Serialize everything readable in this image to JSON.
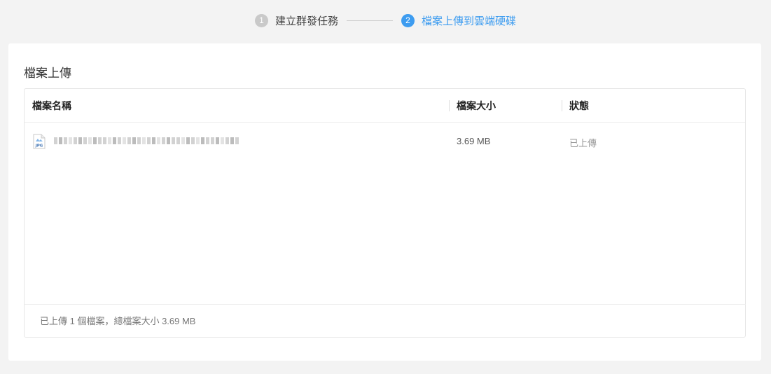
{
  "steps": [
    {
      "number": "1",
      "label": "建立群發任務",
      "state": "done"
    },
    {
      "number": "2",
      "label": "檔案上傳到雲端硬碟",
      "state": "active"
    }
  ],
  "colors": {
    "accent": "#3d9cf0",
    "step_inactive": "#c9c9c9",
    "background": "#f3f3f3"
  },
  "card": {
    "title": "檔案上傳"
  },
  "table": {
    "columns": {
      "name": "檔案名稱",
      "size": "檔案大小",
      "status": "狀態"
    },
    "rows": [
      {
        "file_type": "JPG",
        "file_icon": "jpg-file-icon",
        "name_redacted": true,
        "size": "3.69 MB",
        "status": "已上傳"
      }
    ]
  },
  "summary": {
    "text": "已上傳 1 個檔案，總檔案大小 3.69 MB"
  }
}
